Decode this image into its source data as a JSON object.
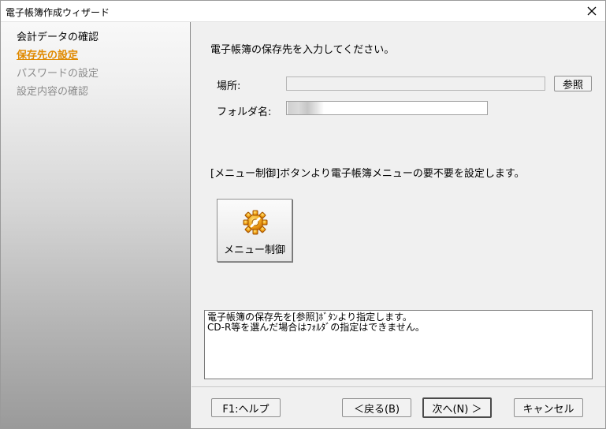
{
  "window": {
    "title": "電子帳簿作成ウィザード"
  },
  "sidebar": {
    "steps": [
      {
        "label": "会計データの確認",
        "state": "done"
      },
      {
        "label": "保存先の設定",
        "state": "current"
      },
      {
        "label": "パスワードの設定",
        "state": "pending"
      },
      {
        "label": "設定内容の確認",
        "state": "pending"
      }
    ]
  },
  "main": {
    "instruction": "電子帳簿の保存先を入力してください。",
    "location_label": "場所:",
    "location_value": "",
    "browse_button": "参照",
    "folder_label": "フォルダ名:",
    "folder_value": "",
    "menu_note": "[メニュー制御]ボタンより電子帳簿メニューの要不要を設定します。",
    "menu_button": "メニュー制御",
    "help_lines": [
      "電子帳簿の保存先を[参照]ﾎﾞﾀﾝより指定します。",
      "CD-R等を選んだ場合はﾌｫﾙﾀﾞの指定はできません。"
    ]
  },
  "footer": {
    "help_button": "F1:ヘルプ",
    "back_button": "＜戻る(B)",
    "next_button": "次へ(N) ＞",
    "cancel_button": "キャンセル"
  },
  "colors": {
    "current_step": "#e08a00",
    "pending_step": "#8c8c8c"
  },
  "icons": {
    "close": "close-icon",
    "menu": "gear-icon"
  }
}
